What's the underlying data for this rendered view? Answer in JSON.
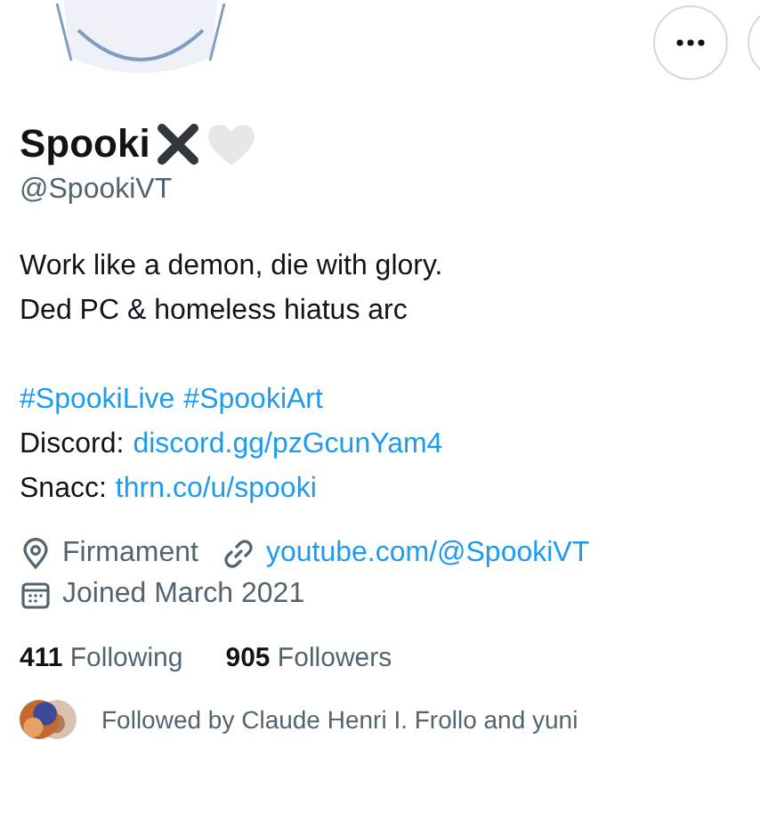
{
  "profile": {
    "name": "Spooki",
    "handle": "@SpookiVT"
  },
  "bio": {
    "paragraphs": [
      [
        [
          {
            "text": "Work like a demon, die with glory.",
            "kind": "plain"
          }
        ],
        [
          {
            "text": "Ded PC & homeless hiatus arc",
            "kind": "plain"
          }
        ]
      ],
      [
        [
          {
            "text": "#SpookiLive",
            "kind": "link"
          },
          {
            "text": "#SpookiArt",
            "kind": "link"
          }
        ],
        [
          {
            "text": "Discord:",
            "kind": "plain"
          },
          {
            "text": "discord.gg/pzGcunYam4",
            "kind": "link"
          }
        ],
        [
          {
            "text": "Snacc:",
            "kind": "plain"
          },
          {
            "text": "thrn.co/u/spooki",
            "kind": "link"
          }
        ]
      ]
    ]
  },
  "meta": [
    {
      "kind": "location",
      "text": "Firmament"
    },
    {
      "kind": "url",
      "text": "youtube.com/@SpookiVT"
    },
    {
      "kind": "joined",
      "text": "Joined March 2021"
    }
  ],
  "stats": [
    {
      "count": "411",
      "label": "Following"
    },
    {
      "count": "905",
      "label": "Followers"
    }
  ],
  "followed_by": "Followed by Claude Henri I. Frollo and yuni"
}
